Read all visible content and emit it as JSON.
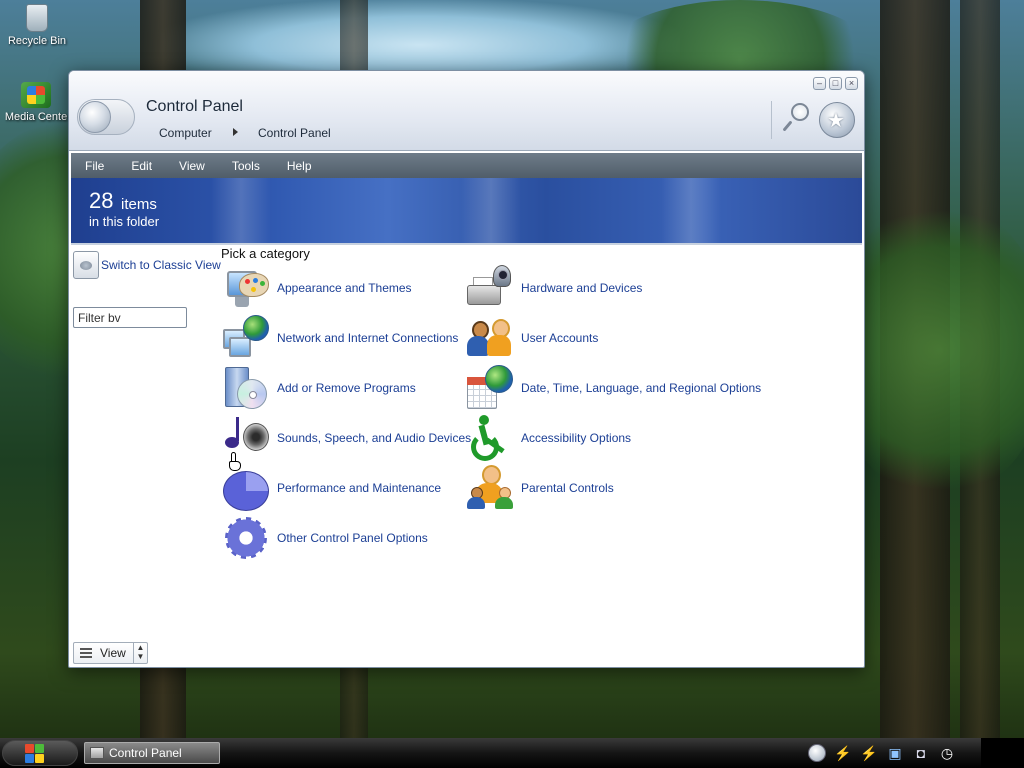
{
  "desktop": {
    "icons": [
      {
        "label": "Recycle Bin",
        "icon": "recycle-bin-icon"
      },
      {
        "label": "Media Cente",
        "icon": "media-center-icon"
      }
    ]
  },
  "window": {
    "title": "Control Panel",
    "breadcrumb": [
      "Computer",
      "Control Panel"
    ],
    "controls": {
      "minimize": "–",
      "maximize": "□",
      "close": "×"
    },
    "menu": [
      "File",
      "Edit",
      "View",
      "Tools",
      "Help"
    ],
    "banner": {
      "count": "28",
      "count_word": "items",
      "subtitle": "in this folder"
    },
    "left_pane": {
      "classic_view_label": "Switch to Classic View",
      "filter_value": "Filter bv",
      "view_label": "View"
    },
    "main": {
      "heading": "Pick a category",
      "categories_left": [
        {
          "label": "Appearance and Themes",
          "icon": "appearance-themes-icon"
        },
        {
          "label": "Network and Internet Connections",
          "icon": "network-connections-icon"
        },
        {
          "label": "Add or Remove Programs",
          "icon": "add-remove-programs-icon"
        },
        {
          "label": "Sounds, Speech, and Audio Devices",
          "icon": "sounds-audio-icon"
        },
        {
          "label": "Performance and Maintenance",
          "icon": "performance-maintenance-icon"
        },
        {
          "label": "Other Control Panel Options",
          "icon": "other-options-gear-icon"
        }
      ],
      "categories_right": [
        {
          "label": "Hardware and Devices",
          "icon": "hardware-devices-icon"
        },
        {
          "label": "User Accounts",
          "icon": "user-accounts-icon"
        },
        {
          "label": "Date, Time, Language, and Regional Options",
          "icon": "date-time-regional-icon"
        },
        {
          "label": "Accessibility Options",
          "icon": "accessibility-icon"
        },
        {
          "label": "Parental Controls",
          "icon": "parental-controls-icon"
        }
      ]
    }
  },
  "taskbar": {
    "start_icon": "windows-start-icon",
    "tasks": [
      {
        "label": "Control Panel",
        "icon": "control-panel-task-icon"
      }
    ],
    "tray_icons": [
      "tray-bubble-icon",
      "lightning-icon",
      "lightning-icon",
      "network-icon",
      "volume-icon",
      "clock-icon"
    ]
  },
  "colors": {
    "link": "#1c3f95",
    "banner": "#2f58b0",
    "menubar": "#5e6b78",
    "taskbar": "#151515"
  }
}
